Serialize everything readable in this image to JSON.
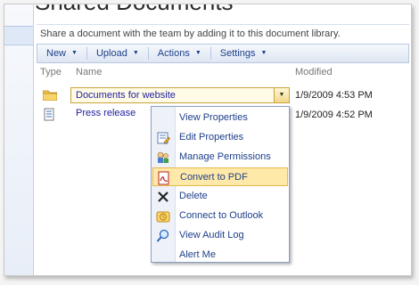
{
  "page_title": "Shared Documents",
  "description": "Share a document with the team by adding it to this document library.",
  "toolbar": {
    "new": "New",
    "upload": "Upload",
    "actions": "Actions",
    "settings": "Settings"
  },
  "columns": {
    "type": "Type",
    "name": "Name",
    "modified": "Modified"
  },
  "rows": [
    {
      "name": "Documents for website",
      "modified": "1/9/2009 4:53 PM",
      "icon": "folder-icon"
    },
    {
      "name": "Press release",
      "modified": "1/9/2009 4:52 PM",
      "icon": "document-icon"
    }
  ],
  "context_menu": {
    "items": [
      {
        "label": "View Properties",
        "icon": ""
      },
      {
        "label": "Edit Properties",
        "icon": "edit-properties-icon"
      },
      {
        "label": "Manage Permissions",
        "icon": "permissions-icon"
      },
      {
        "label": "Convert to PDF",
        "icon": "pdf-icon",
        "highlighted": true
      },
      {
        "label": "Delete",
        "icon": "delete-x-icon"
      },
      {
        "label": "Connect to Outlook",
        "icon": "outlook-icon"
      },
      {
        "label": "View Audit Log",
        "icon": "audit-log-icon"
      },
      {
        "label": "Alert Me",
        "icon": ""
      }
    ]
  },
  "colors": {
    "link": "#1f1f9d",
    "highlight": "#ffe9a8",
    "toolbar_text": "#1c3f8a"
  }
}
